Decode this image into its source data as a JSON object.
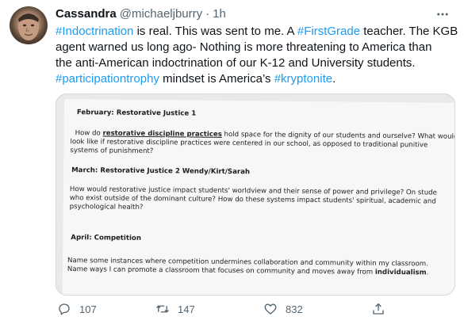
{
  "tweet": {
    "author": {
      "display_name": "Cassandra",
      "handle": "@michaeljburry",
      "separator": "·",
      "time": "1h"
    },
    "text_lines": [
      [
        {
          "t": "#Indoctrination",
          "tag": true
        },
        {
          "t": " is real. This was sent to me. A ",
          "tag": false
        },
        {
          "t": "#FirstGrade",
          "tag": true
        },
        {
          "t": " teacher. The KGB",
          "tag": false
        }
      ],
      [
        {
          "t": "agent warned us long ago- Nothing is more threatening to America than",
          "tag": false
        }
      ],
      [
        {
          "t": "the anti-American indoctrination of our K-12 and University students.",
          "tag": false
        }
      ],
      [
        {
          "t": "#participationtrophy",
          "tag": true
        },
        {
          "t": " mindset is America’s ",
          "tag": false
        },
        {
          "t": "#kryptonite",
          "tag": true
        },
        {
          "t": ".",
          "tag": false
        }
      ]
    ],
    "image_document": {
      "feb_heading": "February: Restorative Justice 1",
      "feb_p1_pre": "How do ",
      "feb_p1_term": "restorative discipline practices",
      "feb_p1_post": " hold space for the dignity of our students and ourselve? What would",
      "feb_p2": "look like if restorative discipline practices were centered in our school, as opposed to traditional punitive",
      "feb_p3": "systems of punishment?",
      "mar_heading": "March: Restorative Justice 2    Wendy/Kirt/Sarah",
      "mar_p1": "How would restorative justice  impact students' worldview and their sense of power and privilege?  On stude",
      "mar_p2": "who exist outside of the dominant culture? How do these systems impact students' spiritual, academic and",
      "mar_p3": "psychological health?",
      "apr_heading": "April:  Competition",
      "apr_p1": "Name some instances where competition undermines collaboration and community within my classroom.",
      "apr_p2_pre": "Name ways I can promote a classroom that focuses on community and moves away from ",
      "apr_p2_term": "individualism",
      "apr_p2_post": "."
    },
    "actions": {
      "replies": "107",
      "retweets": "147",
      "likes": "832"
    },
    "icons": [
      "more-icon",
      "reply-icon",
      "retweet-icon",
      "like-icon",
      "share-icon"
    ],
    "colors": {
      "link": "#1d9bf0",
      "secondary_text": "#536471",
      "primary_text": "#0f1419"
    }
  }
}
